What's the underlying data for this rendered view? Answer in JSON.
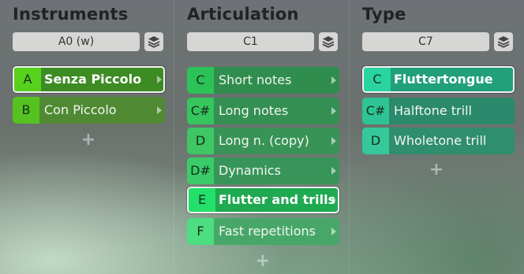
{
  "columns": [
    {
      "title": "Instruments",
      "selector": "A0 (w)",
      "items": [
        {
          "key": "A",
          "label": "Senza Piccolo",
          "selected": true,
          "key_bg": "#56d21c",
          "bg": "#3d8c23"
        },
        {
          "key": "B",
          "label": "Con Piccolo",
          "selected": false,
          "key_bg": "#55c221",
          "bg": "#4f8a32"
        }
      ]
    },
    {
      "title": "Articulation",
      "selector": "C1",
      "items": [
        {
          "key": "C",
          "label": "Short notes",
          "selected": false,
          "key_bg": "#2dc258",
          "bg": "#2f8d4d"
        },
        {
          "key": "C#",
          "label": "Long notes",
          "selected": false,
          "key_bg": "#36c55e",
          "bg": "#338f52"
        },
        {
          "key": "D",
          "label": "Long n. (copy)",
          "selected": false,
          "key_bg": "#3ec764",
          "bg": "#389456"
        },
        {
          "key": "D#",
          "label": "Dynamics",
          "selected": false,
          "key_bg": "#3bcc69",
          "bg": "#379559"
        },
        {
          "key": "E",
          "label": "Flutter and trills",
          "selected": true,
          "key_bg": "#22e06a",
          "bg": "#1fa951"
        },
        {
          "key": "F",
          "label": "Fast repetitions",
          "selected": false,
          "key_bg": "#4cde80",
          "bg": "#47a769"
        }
      ]
    },
    {
      "title": "Type",
      "selector": "C7",
      "items": [
        {
          "key": "C",
          "label": "Fluttertongue",
          "selected": true,
          "key_bg": "#2ad4a0",
          "bg": "#21a07a"
        },
        {
          "key": "C#",
          "label": "Halftone trill",
          "selected": false,
          "key_bg": "#2fc495",
          "bg": "#2a8a6b"
        },
        {
          "key": "D",
          "label": "Wholetone trill",
          "selected": false,
          "key_bg": "#36c89a",
          "bg": "#2f8e6e"
        }
      ]
    }
  ],
  "icons": {
    "stack": "stack-layers-icon",
    "add": "plus-icon",
    "arrow": "chevron-right-icon"
  },
  "add_label": "+"
}
